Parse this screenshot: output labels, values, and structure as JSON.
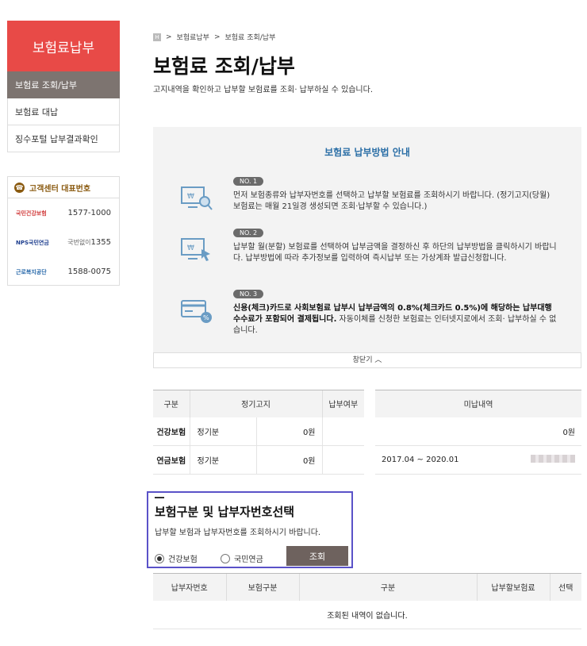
{
  "sidebar": {
    "header": "보험료납부",
    "items": [
      {
        "label": "보험료 조회/납부",
        "active": true
      },
      {
        "label": "보험료 대납",
        "active": false
      },
      {
        "label": "징수포털 납부결과확인",
        "active": false
      }
    ]
  },
  "callcenter": {
    "title": "고객센터 대표번호",
    "rows": [
      {
        "logo": "국민건강보험",
        "number": "1577-1000",
        "prefix": ""
      },
      {
        "logo": "NPS국민연금",
        "number": "1355",
        "prefix": "국번없이"
      },
      {
        "logo": "근로복지공단",
        "number": "1588-0075",
        "prefix": ""
      }
    ]
  },
  "breadcrumb": {
    "home": "H",
    "items": [
      "보험료납부",
      "보험료 조회/납부"
    ]
  },
  "page": {
    "title": "보험료 조회/납부",
    "subtitle": "고지내역을 확인하고 납부할 보험료를 조회· 납부하실 수 있습니다."
  },
  "guide": {
    "title": "보험료 납부방법 안내",
    "steps": [
      {
        "badge": "NO. 1",
        "text": "먼저 보험종류와 납부자번호를 선택하고 납부할 보험료를 조회하시기 바랍니다. (정기고지(당월) 보험료는 매월 21일경 생성되면 조회·납부할 수 있습니다.)"
      },
      {
        "badge": "NO. 2",
        "text": "납부할 월(분할) 보험료를 선택하여 납부금액을 결정하신 후 하단의 납부방법을 클릭하시기 바랍니다. 납부방법에 따라 추가정보를 입력하여 즉시납부 또는 가상계좌 발급신청합니다."
      },
      {
        "badge": "NO. 3",
        "text_bold": "신용(체크)카드로 사회보험료 납부시 납부금액의 0.8%(체크카드 0.5%)에 해당하는 납부대행 수수료가 포함되어 결제됩니다.",
        "text": " 자동이체를 신청한 보험료는 인터넷지로에서 조회· 납부하실 수 없습니다."
      }
    ],
    "close_label": "창닫기 ︿"
  },
  "summary": {
    "headers": [
      "구분",
      "정기고지",
      "납부여부"
    ],
    "rows": [
      {
        "type": "건강보험",
        "kind": "정기분",
        "amount": "0원",
        "paid": ""
      },
      {
        "type": "연금보험",
        "kind": "정기분",
        "amount": "0원",
        "paid": ""
      }
    ]
  },
  "unpaid": {
    "header": "미납내역",
    "rows": [
      {
        "period": "",
        "amount": "0원"
      },
      {
        "period": "2017.04 ~ 2020.01",
        "amount": ""
      }
    ]
  },
  "selection": {
    "title": "보험구분 및 납부자번호선택",
    "desc": "납부할 보험과 납부자번호를 조회하시기 바랍니다.",
    "options": [
      {
        "label": "건강보험",
        "checked": true
      },
      {
        "label": "국민연금",
        "checked": false
      }
    ],
    "search_label": "조회"
  },
  "results": {
    "headers": [
      "납부자번호",
      "보험구분",
      "구분",
      "납부할보험료",
      "선택"
    ],
    "empty_message": "조회된 내역이 없습니다."
  }
}
